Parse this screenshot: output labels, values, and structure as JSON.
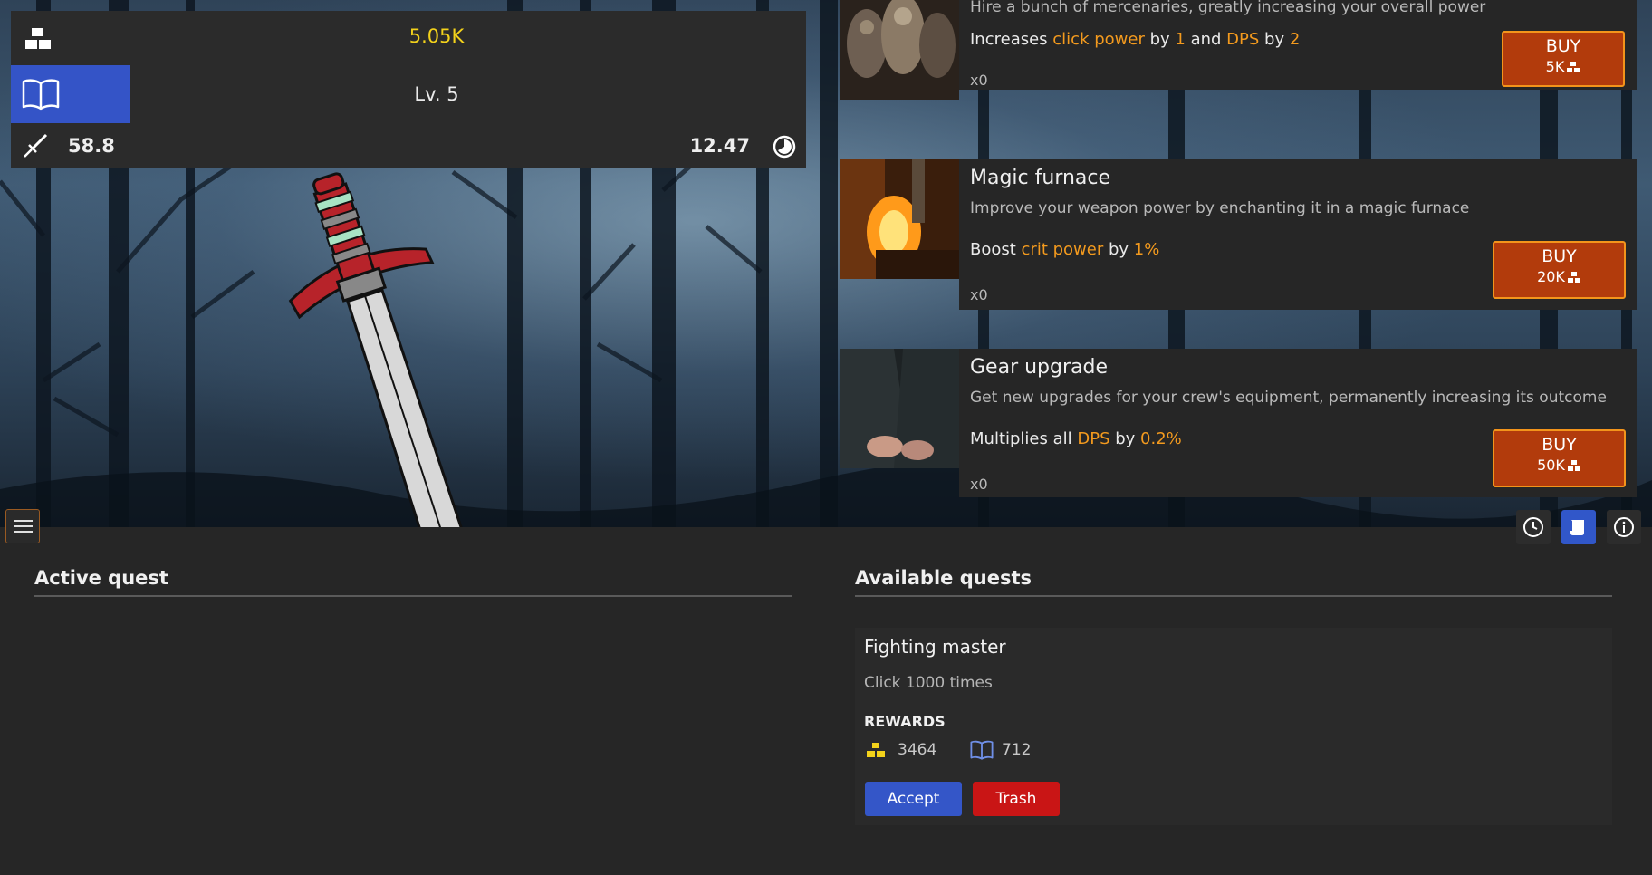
{
  "stats": {
    "gold_icon": "gold-bars-icon",
    "gold": "5.05K",
    "level_icon": "book-icon",
    "level": "Lv. 5",
    "click_icon": "sword-icon",
    "click_damage": "58.8",
    "dps": "12.47",
    "dps_icon": "clock-pie-icon"
  },
  "upgrades": [
    {
      "title": "",
      "description": "Hire a bunch of mercenaries, greatly increasing your overall power",
      "effect": {
        "p1": "Increases ",
        "h1": "click power",
        "p2": " by ",
        "h2": "1",
        "p3": " and ",
        "h3": "DPS",
        "p4": " by ",
        "h4": "2"
      },
      "owned": "x0",
      "buy_label": "BUY",
      "cost": "5K"
    },
    {
      "title": "Magic furnace",
      "description": "Improve your weapon power by enchanting it in a magic furnace",
      "effect": {
        "p1": "Boost ",
        "h1": "crit power",
        "p2": " by ",
        "h2": "1%"
      },
      "owned": "x0",
      "buy_label": "BUY",
      "cost": "20K"
    },
    {
      "title": "Gear upgrade",
      "description": "Get new upgrades for your crew's equipment, permanently increasing its outcome",
      "effect": {
        "p1": "Multiplies all ",
        "h1": "DPS",
        "p2": " by ",
        "h2": "0.2%"
      },
      "owned": "x0",
      "buy_label": "BUY",
      "cost": "50K"
    }
  ],
  "toolbar": {
    "menu_icon": "hamburger-icon",
    "history_icon": "clock-icon",
    "quests_icon": "scroll-icon",
    "info_icon": "info-icon"
  },
  "active_quest": {
    "title": "Active quest"
  },
  "available_quests": {
    "title": "Available quests",
    "quest": {
      "name": "Fighting master",
      "description": "Click 1000 times",
      "rewards_label": "REWARDS",
      "reward_gold": "3464",
      "reward_xp": "712",
      "accept_label": "Accept",
      "trash_label": "Trash"
    }
  },
  "colors": {
    "accent_blue": "#3454c7",
    "gold": "#f3d21b",
    "highlight_orange": "#f39a1e",
    "buy_button": "#b23b0c",
    "trash_red": "#c91515"
  }
}
